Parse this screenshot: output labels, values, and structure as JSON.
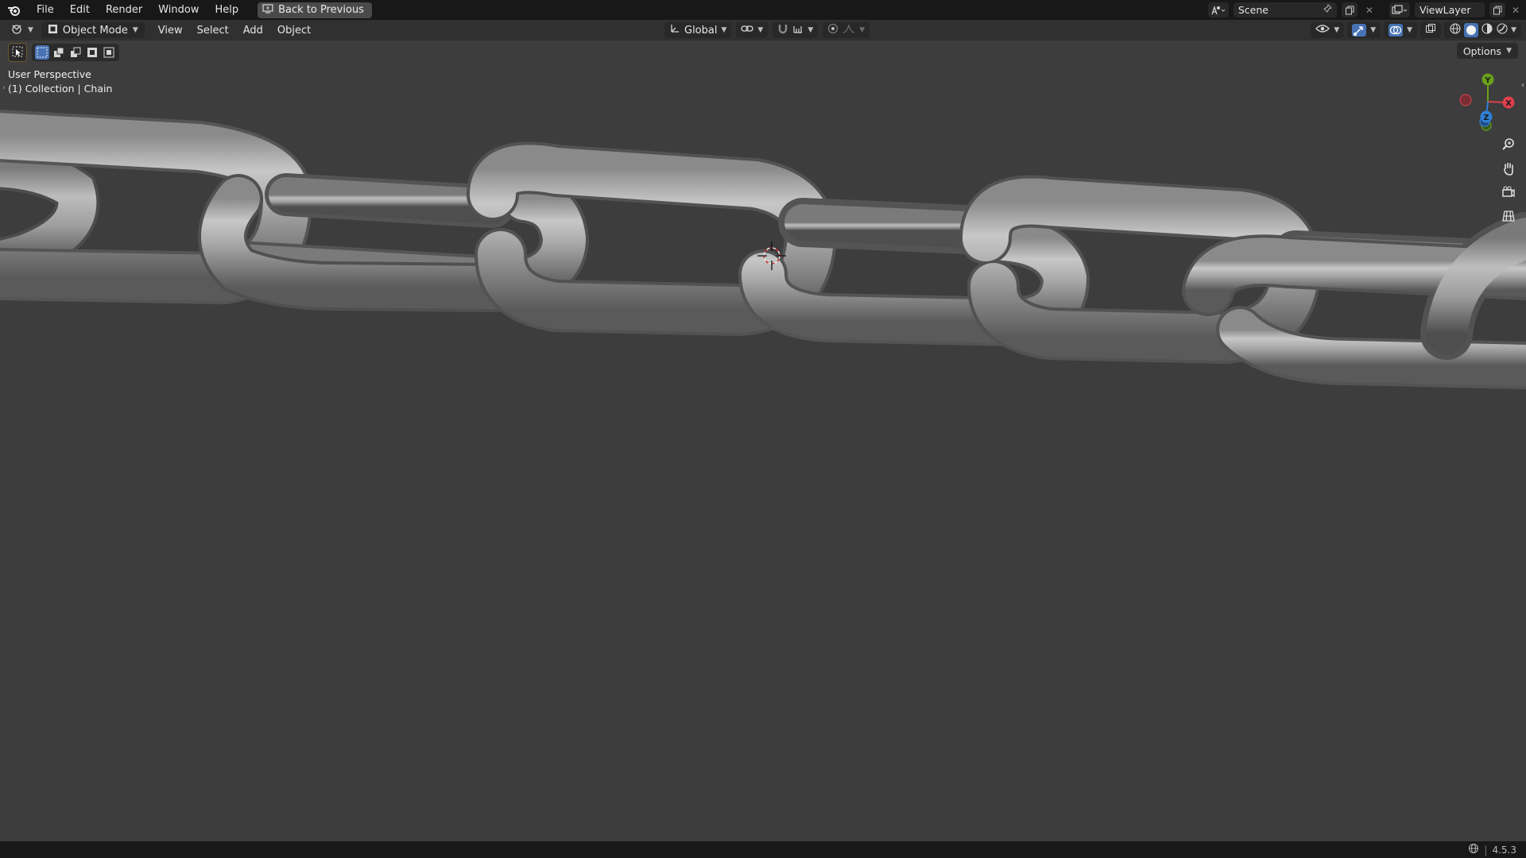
{
  "menu": {
    "file": "File",
    "edit": "Edit",
    "render": "Render",
    "window": "Window",
    "help": "Help",
    "back": "Back to Previous"
  },
  "topright": {
    "scene": "Scene",
    "viewlayer": "ViewLayer"
  },
  "header": {
    "mode": "Object Mode",
    "view": "View",
    "select": "Select",
    "add": "Add",
    "object": "Object",
    "orientation": "Global"
  },
  "toolbar": {
    "options": "Options"
  },
  "viewport": {
    "perspective": "User Perspective",
    "collection": "(1) Collection | Chain"
  },
  "gizmo": {
    "x": "X",
    "y": "Y",
    "z": "Z"
  },
  "status": {
    "version": "4.5.3"
  },
  "colors": {
    "x_axis": "#e0404b",
    "y_axis": "#6ba01b",
    "z_axis": "#2f7fd8",
    "accent": "#4772b3"
  }
}
